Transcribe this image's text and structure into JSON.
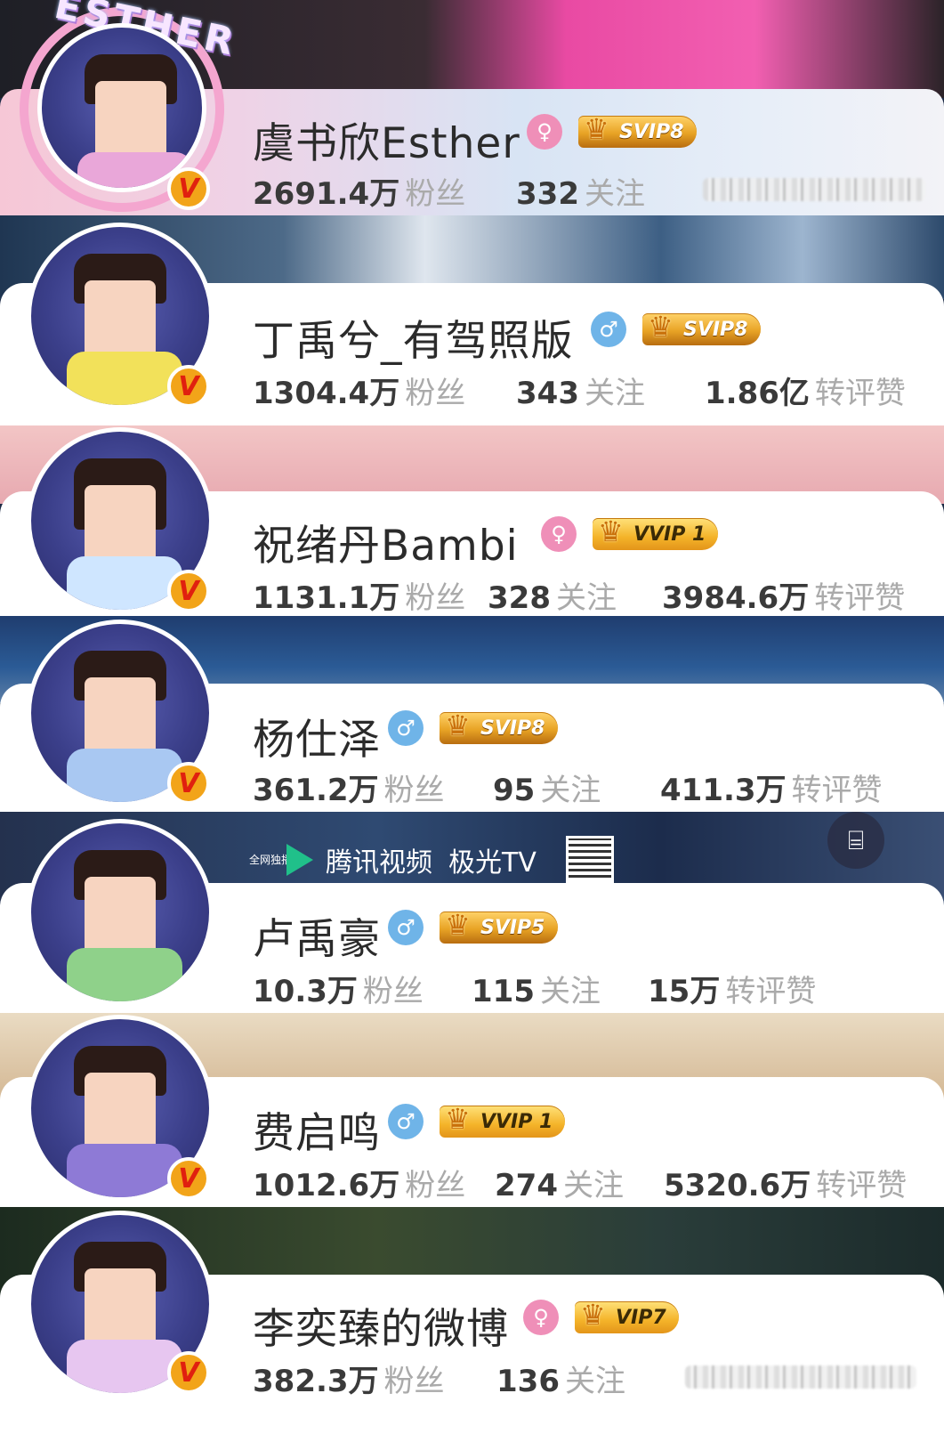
{
  "profiles": [
    {
      "name": "虞书欣Esther",
      "gender": "female",
      "gender_symbol": "♀",
      "vip": "SVIP8",
      "fans_value": "2691.4万",
      "fans_label": "粉丝",
      "following_value": "332",
      "following_label": "关注",
      "avatar_ring_text": "ESTHER",
      "robe_color": "#e9a7d9"
    },
    {
      "name": "丁禹兮_有驾照版",
      "gender": "male",
      "gender_symbol": "♂",
      "vip": "SVIP8",
      "fans_value": "1304.4万",
      "fans_label": "粉丝",
      "following_value": "343",
      "following_label": "关注",
      "interactions_value": "1.86亿",
      "interactions_label": "转评赞",
      "robe_color": "#f2e15a"
    },
    {
      "name": "祝绪丹Bambi",
      "gender": "female",
      "gender_symbol": "♀",
      "vip": "VVIP 1",
      "fans_value": "1131.1万",
      "fans_label": "粉丝",
      "following_value": "328",
      "following_label": "关注",
      "interactions_value": "3984.6万",
      "interactions_label": "转评赞",
      "robe_color": "#cfe6ff"
    },
    {
      "name": "杨仕泽",
      "gender": "male",
      "gender_symbol": "♂",
      "vip": "SVIP8",
      "fans_value": "361.2万",
      "fans_label": "粉丝",
      "following_value": "95",
      "following_label": "关注",
      "interactions_value": "411.3万",
      "interactions_label": "转评赞",
      "robe_color": "#a9c8f2"
    },
    {
      "name": "卢禹豪",
      "gender": "male",
      "gender_symbol": "♂",
      "vip": "SVIP5",
      "fans_value": "10.3万",
      "fans_label": "粉丝",
      "following_value": "115",
      "following_label": "关注",
      "interactions_value": "15万",
      "interactions_label": "转评赞",
      "robe_color": "#8fd18a"
    },
    {
      "name": "费启鸣",
      "gender": "male",
      "gender_symbol": "♂",
      "vip": "VVIP 1",
      "fans_value": "1012.6万",
      "fans_label": "粉丝",
      "following_value": "274",
      "following_label": "关注",
      "interactions_value": "5320.6万",
      "interactions_label": "转评赞",
      "robe_color": "#8e7ad6"
    },
    {
      "name": "李奕臻的微博",
      "gender": "female",
      "gender_symbol": "♀",
      "vip": "VIP7",
      "fans_value": "382.3万",
      "fans_label": "粉丝",
      "following_value": "136",
      "following_label": "关注",
      "robe_color": "#e7c6f0"
    }
  ],
  "verified_symbol": "V",
  "crown_symbol": "♛",
  "banner": {
    "small_text": "全网独播",
    "service_name": "腾讯视频",
    "tv_name": "极光TV"
  },
  "colors": {
    "female_badge": "#ef8fb8",
    "male_badge": "#6fb4e8",
    "verified_badge": "#f2a419",
    "vip_gold": "#f4b329",
    "label_gray": "#aaaaaa"
  }
}
